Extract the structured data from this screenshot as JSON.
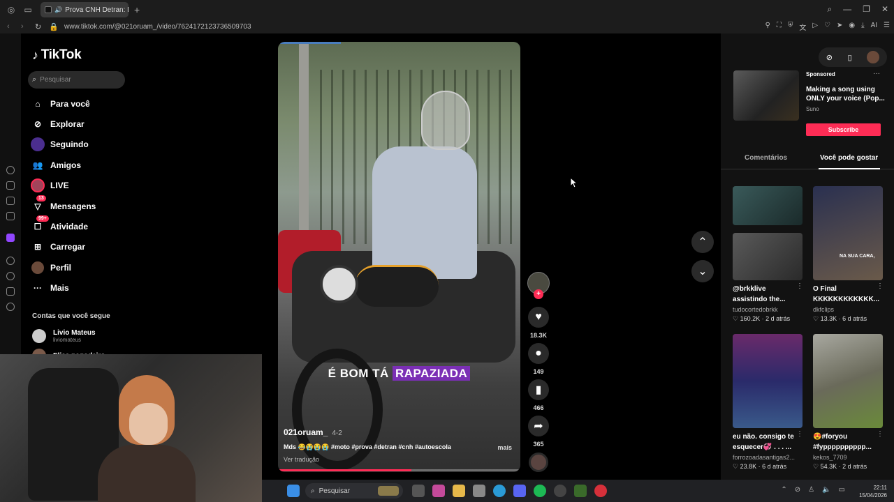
{
  "browser": {
    "tab_title": "Prova CNH Detran: Di",
    "url": "www.tiktok.com/@021oruam_/video/7624172123736509703",
    "new_tab": "+"
  },
  "sidebar": {
    "logo": "TikTok",
    "search_placeholder": "Pesquisar",
    "items": [
      {
        "label": "Para você",
        "icon": "home-icon"
      },
      {
        "label": "Explorar",
        "icon": "compass-icon"
      },
      {
        "label": "Seguindo",
        "icon": "following-avatar-icon"
      },
      {
        "label": "Amigos",
        "icon": "friends-icon"
      },
      {
        "label": "LIVE",
        "icon": "live-icon"
      },
      {
        "label": "Mensagens",
        "icon": "messages-icon",
        "badge": "13"
      },
      {
        "label": "Atividade",
        "icon": "activity-icon",
        "badge": "99+"
      },
      {
        "label": "Carregar",
        "icon": "upload-icon"
      },
      {
        "label": "Perfil",
        "icon": "profile-icon"
      },
      {
        "label": "Mais",
        "icon": "more-icon"
      }
    ],
    "following_title": "Contas que você segue",
    "accounts": [
      {
        "name": "Livio Mateus",
        "handle": "liviomateus"
      },
      {
        "name": "Elias pagodeiro...",
        "handle": ""
      }
    ]
  },
  "video": {
    "caption_plain": "É BOM TÁ",
    "caption_highlight": "RAPAZIADA",
    "author": "021oruam_",
    "date": "4-2",
    "description": "Mds 😂😭😭😭 #moto #prova #detran #cnh #autoescola",
    "more": "mais",
    "translation": "Ver tradução",
    "progress": 0.55,
    "likes": "18.3K",
    "comments": "149",
    "saves": "466",
    "shares": "365"
  },
  "right_panel": {
    "ad": {
      "sponsored": "Sponsored",
      "title": "Making a song using ONLY your voice (Pop...",
      "brand": "Suno",
      "button": "Subscribe"
    },
    "tabs": [
      "Comentários",
      "Você pode gostar"
    ],
    "cards": [
      {
        "title": "@brkklive",
        "title2": "assistindo the...",
        "author": "tudocortedobrkk",
        "likes": "160.2K",
        "date": "2 d atrás"
      },
      {
        "title": "O Final",
        "title2": "KKKKKKKKKKKK...",
        "author": "dkfclips",
        "likes": "13.3K",
        "date": "6 d atrás",
        "overlay": "NA SUA CARA,"
      },
      {
        "title": "eu não. consigo te",
        "title2": "esquecer💞 . . . ...",
        "author": "forrozoadasantigas2...",
        "likes": "23.8K",
        "date": "6 d atrás"
      },
      {
        "title": "😍#foryou",
        "title2": "#fypppppppppp...",
        "author": "kekos_7709",
        "likes": "54.3K",
        "date": "2 d atrás"
      }
    ]
  },
  "taskbar": {
    "search": "Pesquisar",
    "time": "22:11",
    "date": "15/04/2026"
  },
  "colors": {
    "accent": "#fe2c55",
    "caption_highlight": "#7b2fb5"
  }
}
